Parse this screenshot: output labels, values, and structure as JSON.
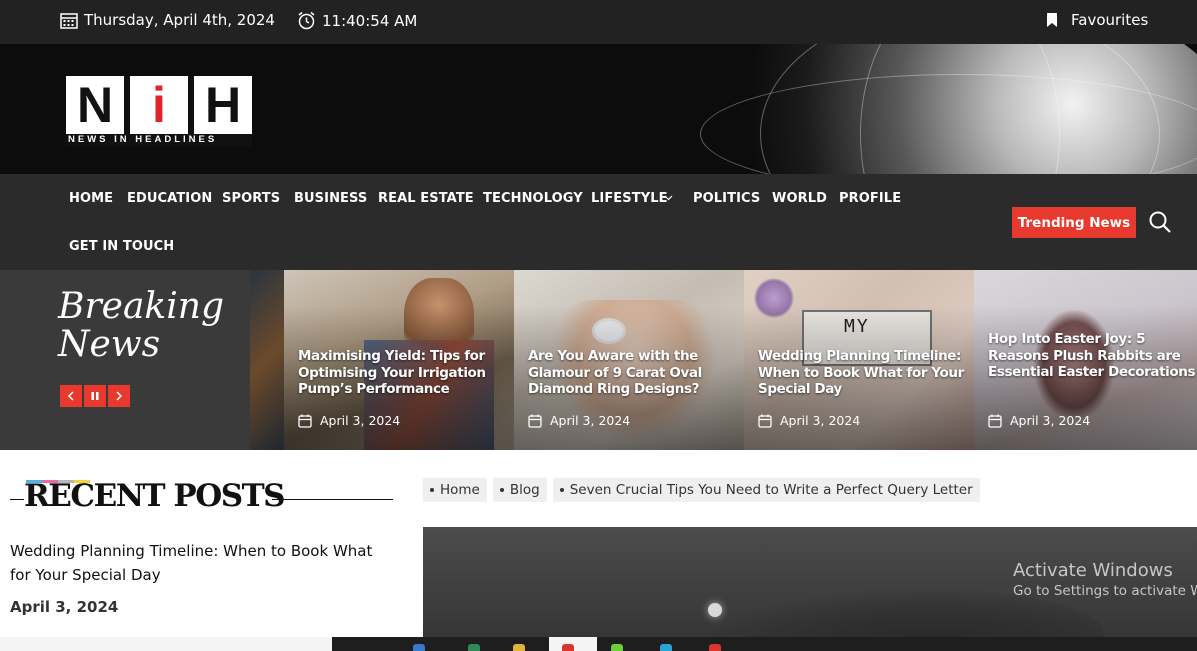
{
  "topbar": {
    "date": "Thursday, April 4th, 2024",
    "time": "11:40:54 AM",
    "favourites": "Favourites",
    "calendar_icon": "calendar-icon",
    "clock_icon": "alarm-clock-icon",
    "bookmark_icon": "bookmark-icon"
  },
  "logo": {
    "letters": [
      "N",
      "i",
      "H"
    ],
    "tagline": "NEWS IN HEADLINES"
  },
  "nav": {
    "items": [
      "HOME",
      "EDUCATION",
      "SPORTS",
      "BUSINESS",
      "REAL ESTATE",
      "TECHNOLOGY",
      "LIFESTYLE",
      "POLITICS",
      "WORLD",
      "PROFILE",
      "GET IN TOUCH"
    ],
    "trending": "Trending News",
    "accent": "#e8392f"
  },
  "breaking": {
    "line1": "Breaking",
    "line2": "News",
    "slides": [
      {
        "title": "Maximising Yield: Tips for Optimising Your Irrigation Pump’s Performance",
        "date": "April 3, 2024"
      },
      {
        "title": "Are You Aware with the Glamour of 9 Carat Oval Diamond Ring Designs?",
        "date": "April 3, 2024"
      },
      {
        "title": "Wedding Planning Timeline: When to Book What for Your Special Day",
        "date": "April 3, 2024"
      },
      {
        "title": "Hop Into Easter Joy: 5 Reasons Plush Rabbits are Essential Easter Decorations",
        "date": "April 3, 2024"
      }
    ]
  },
  "recent": {
    "heading": "RECENT POSTS",
    "post_title": "Wedding Planning Timeline: When to Book What for Your Special Day",
    "post_date": "April 3, 2024"
  },
  "breadcrumb": [
    "Home",
    "Blog",
    "Seven Crucial Tips You Need to Write a Perfect Query Letter"
  ],
  "watermark": {
    "line1": "Activate Windows",
    "line2": "Go to Settings to activate Windows."
  }
}
